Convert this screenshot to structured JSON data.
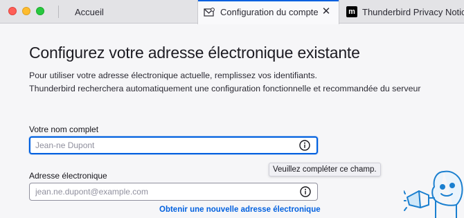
{
  "tabs": [
    {
      "label": "Accueil",
      "icon": "home-icon",
      "active": false
    },
    {
      "label": "Configuration du compte",
      "icon": "account-setup-icon",
      "active": true
    },
    {
      "label": "Thunderbird Privacy Notice",
      "icon": "m-logo-icon",
      "active": false
    }
  ],
  "page": {
    "title": "Configurez votre adresse électronique existante",
    "description_line1": "Pour utiliser votre adresse électronique actuelle, remplissez vos identifiants.",
    "description_line2": "Thunderbird recherchera automatiquement une configuration fonctionnelle et recommandée du serveur"
  },
  "form": {
    "name_label": "Votre nom complet",
    "name_value": "",
    "name_placeholder": "Jean-ne Dupont",
    "email_label": "Adresse électronique",
    "email_value": "",
    "email_placeholder": "jean.ne.dupont@example.com",
    "tooltip": "Veuillez compléter ce champ.",
    "new_address_link": "Obtenir une nouvelle adresse électronique"
  },
  "colors": {
    "accent": "#0060df",
    "tooltip_bg": "#f0f0f4",
    "close_red": "#fe5f57",
    "minimize_yellow": "#febc2e",
    "zoom_green": "#28c840"
  }
}
